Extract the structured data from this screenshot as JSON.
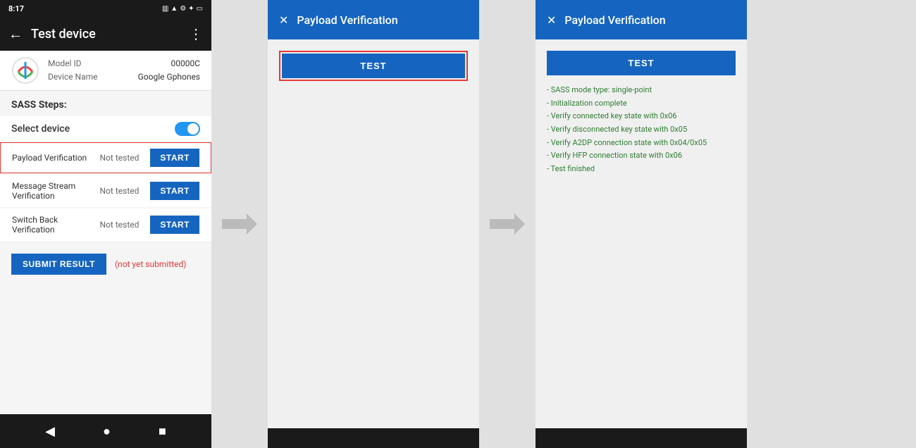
{
  "phone": {
    "status_bar": {
      "time": "8:17",
      "icons_left": [
        "sim",
        "wifi",
        "settings",
        "bluetooth",
        "dot"
      ]
    },
    "toolbar": {
      "title": "Test device",
      "back_label": "←",
      "menu_label": "⋮"
    },
    "device_info": {
      "model_id_label": "Model ID",
      "model_id_value": "00000C",
      "device_name_label": "Device Name",
      "device_name_value": "Google Gphones"
    },
    "sass_steps_label": "SASS Steps:",
    "select_device_label": "Select device",
    "steps": [
      {
        "name": "Payload Verification",
        "status": "Not tested",
        "btn_label": "START",
        "highlighted": true
      },
      {
        "name": "Message Stream Verification",
        "status": "Not tested",
        "btn_label": "START",
        "highlighted": false
      },
      {
        "name": "Switch Back Verification",
        "status": "Not tested",
        "btn_label": "START",
        "highlighted": false
      }
    ],
    "submit_btn_label": "SUBMIT RESULT",
    "submit_status": "(not yet submitted)",
    "nav": {
      "back": "◀",
      "home": "●",
      "recent": "■"
    }
  },
  "dialog1": {
    "title": "Payload Verification",
    "close_label": "✕",
    "test_btn_label": "TEST",
    "highlighted": true
  },
  "dialog2": {
    "title": "Payload Verification",
    "close_label": "✕",
    "test_btn_label": "TEST",
    "results": [
      "- SASS mode type: single-point",
      "- Initialization complete",
      "- Verify connected key state with 0x06",
      "- Verify disconnected key state with 0x05",
      "- Verify A2DP connection state with 0x04/0x05",
      "- Verify HFP connection state with 0x06",
      "- Test finished"
    ]
  },
  "arrow_icon": "→"
}
